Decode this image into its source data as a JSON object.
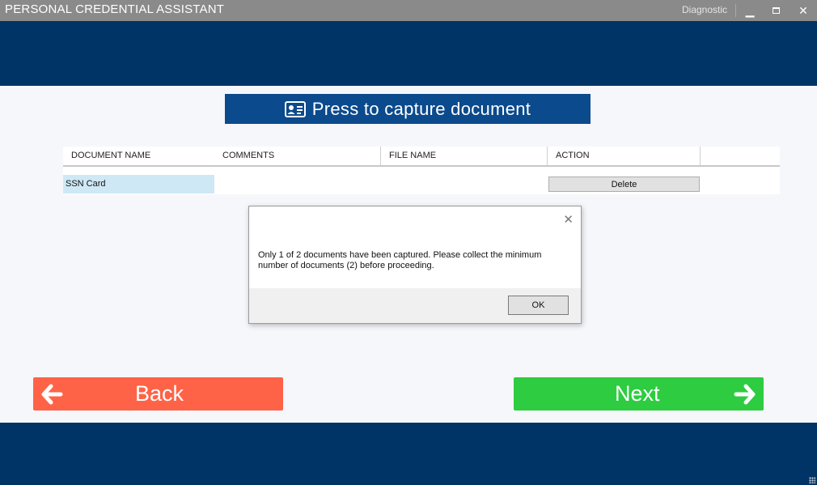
{
  "window": {
    "title": "PERSONAL CREDENTIAL ASSISTANT",
    "diagnostic_label": "Diagnostic",
    "controls": {
      "minimize": "▁",
      "maximize": "maximize-icon",
      "close": "✕"
    }
  },
  "capture": {
    "label": "Press to capture document",
    "icon": "id-card-icon"
  },
  "documents_table": {
    "columns": [
      "DOCUMENT NAME",
      "COMMENTS",
      "FILE NAME",
      "ACTION"
    ],
    "rows": [
      {
        "document_name": "SSN Card",
        "comments": "",
        "file_name": "",
        "action": "Delete"
      }
    ]
  },
  "dialog": {
    "message": "Only 1 of 2 documents have been captured. Please collect the minimum number of documents (2) before proceeding.",
    "close_icon": "✕",
    "ok_label": "OK"
  },
  "nav": {
    "back_label": "Back",
    "next_label": "Next",
    "back_color": "#ff6347",
    "next_color": "#2ecc40"
  },
  "colors": {
    "brand_navy": "#003366",
    "capture_blue": "#0b4a8c",
    "titlebar_gray": "#8a8a8a"
  }
}
